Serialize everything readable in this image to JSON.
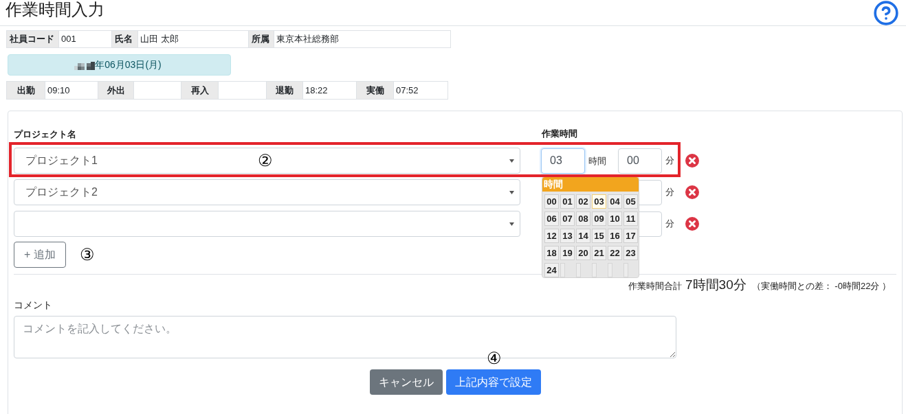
{
  "header": {
    "title": "作業時間入力"
  },
  "employee_info": [
    {
      "label": "社員コード",
      "value": "001"
    },
    {
      "label": "氏名",
      "value": "山田 太郎"
    },
    {
      "label": "所属",
      "value": "東京本社総務部"
    }
  ],
  "date_banner": {
    "text": "年06月03日(月)"
  },
  "attendance": [
    {
      "label": "出勤",
      "value": "09:10"
    },
    {
      "label": "外出"
    },
    {
      "label": "再入"
    },
    {
      "label": "退勤",
      "value": "18:22"
    },
    {
      "label": "実働",
      "value": "07:52"
    }
  ],
  "work_entry": {
    "project_heading": "プロジェクト名",
    "time_heading": "作業時間",
    "rows": [
      {
        "project": "プロジェクト1",
        "hours": {
          "value": "03",
          "focused": true
        },
        "hours_unit": "時間",
        "minutes": "00",
        "minutes_unit": "分",
        "highlighted": true,
        "annotation": "②"
      },
      {
        "project": "プロジェクト2",
        "minutes_unit": "分",
        "highlighted": false
      },
      {
        "minutes_unit": "分",
        "highlighted": false
      }
    ],
    "hour_picker": {
      "title": "時間",
      "options": [
        {
          "label": "00",
          "selected": false
        },
        {
          "label": "01",
          "selected": false
        },
        {
          "label": "02",
          "selected": false
        },
        {
          "label": "03",
          "selected": true
        },
        {
          "label": "04",
          "selected": false
        },
        {
          "label": "05",
          "selected": false
        },
        {
          "label": "06",
          "selected": false
        },
        {
          "label": "07",
          "selected": false
        },
        {
          "label": "08",
          "selected": false
        },
        {
          "label": "09",
          "selected": false
        },
        {
          "label": "10",
          "selected": false
        },
        {
          "label": "11",
          "selected": false
        },
        {
          "label": "12",
          "selected": false
        },
        {
          "label": "13",
          "selected": false
        },
        {
          "label": "14",
          "selected": false
        },
        {
          "label": "15",
          "selected": false
        },
        {
          "label": "16",
          "selected": false
        },
        {
          "label": "17",
          "selected": false
        },
        {
          "label": "18",
          "selected": false
        },
        {
          "label": "19",
          "selected": false
        },
        {
          "label": "20",
          "selected": false
        },
        {
          "label": "21",
          "selected": false
        },
        {
          "label": "22",
          "selected": false
        },
        {
          "label": "23",
          "selected": false
        },
        {
          "label": "24",
          "selected": false
        }
      ]
    },
    "add_button": {
      "label": "+ 追加",
      "annotation": "③"
    },
    "total": {
      "label": "作業時間合計",
      "value": "7時間30分",
      "difference": "（実働時間との差： -0時間22分 ）"
    }
  },
  "comment": {
    "label": "コメント",
    "placeholder": "コメントを記入してください。"
  },
  "buttons": [
    {
      "label": "キャンセル",
      "kind": "secondary"
    },
    {
      "label": "上記内容で設定",
      "kind": "primary",
      "annotation": "④"
    }
  ]
}
